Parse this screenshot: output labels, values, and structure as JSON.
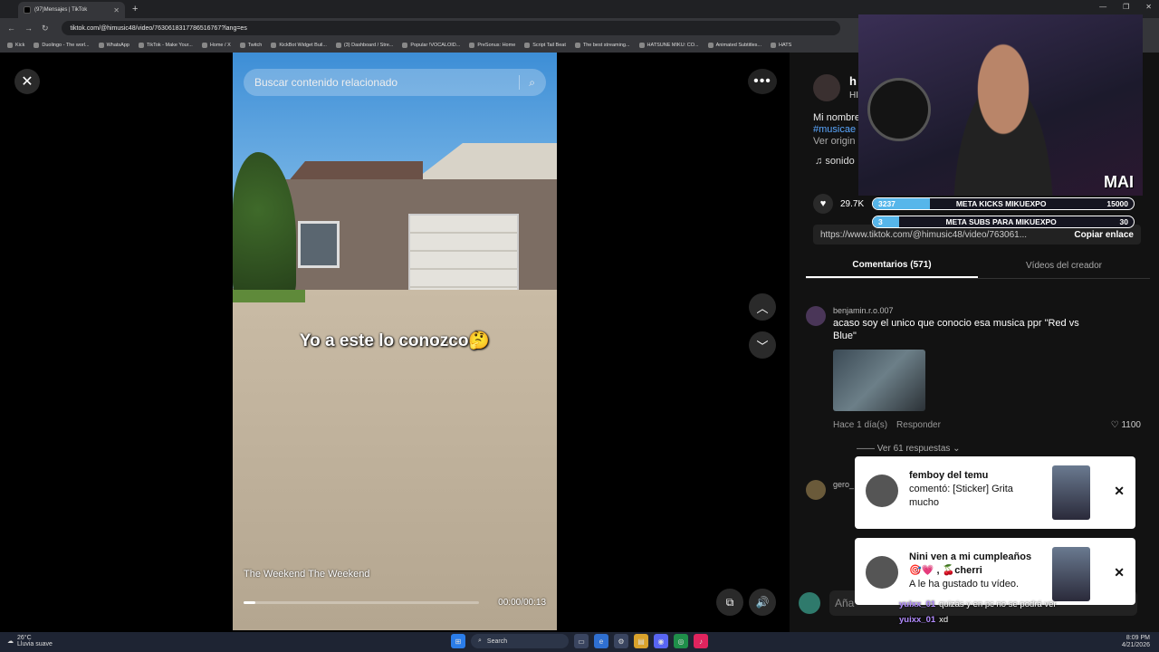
{
  "browser": {
    "tab_title": "(97)Mensajes | TikTok",
    "url": "tiktok.com/@himusic48/video/7630618317786516767?lang=es",
    "bookmarks": [
      "Kick",
      "Duolingo - The worl...",
      "WhatsApp",
      "TikTok - Make Your...",
      "Home / X",
      "Twitch",
      "KickBot Widget Buil...",
      "(3) Dashboard / Stre...",
      "Popular !VOCALOID...",
      "PreSonus: Home",
      "Script Tail Beat",
      "The best streaming...",
      "HATSUNE MIKU: CO...",
      "Animated Subtitles...",
      "HATS"
    ]
  },
  "video": {
    "search_placeholder": "Buscar contenido relacionado",
    "caption": "Yo a este lo conozco🤔",
    "music": "The Weekend The Weekend",
    "time": "00:00/00:13",
    "progress": 0.05
  },
  "author": {
    "name": "h",
    "sub": "HI",
    "desc_line1": "Mi nombre",
    "desc_tag": "#musicae",
    "desc_more": "Ver origin",
    "sound": "sonido"
  },
  "stats": {
    "likes": "29.7K"
  },
  "link": {
    "url": "https://www.tiktok.com/@himusic48/video/763061...",
    "copy_label": "Copiar enlace"
  },
  "tabs": {
    "comments": "Comentarios (571)",
    "creator": "Vídeos del creador"
  },
  "comments": [
    {
      "user": "benjamin.r.o.007",
      "text": "acaso soy el unico que conocio esa musica ppr \"Red vs Blue\"",
      "time": "Hace 1 día(s)",
      "reply": "Responder",
      "likes": "1100",
      "replies": "Ver 61 respuestas"
    },
    {
      "user": "gero_"
    }
  ],
  "comment_bar": {
    "placeholder": "Aña"
  },
  "overlay": {
    "mai": "MAI",
    "goal1": {
      "left": "3237",
      "label": "META KICKS MIKUEXPO",
      "right": "15000",
      "progress": 0.22
    },
    "goal2": {
      "left": "3",
      "label": "META SUBS PARA MIKUEXPO",
      "right": "30",
      "progress": 0.1
    },
    "notifications": [
      {
        "title": "femboy del temu",
        "body": "comentó: [Sticker] Grita mucho"
      },
      {
        "title": "Nini ven a mi cumpleaños 🎯💗 , 🍒cherri",
        "body": "A le ha gustado tu vídeo."
      }
    ],
    "chat": [
      {
        "user": "yuixx_01",
        "msg": "quizás y en pc no se podrá ver"
      },
      {
        "user": "yuixx_01",
        "msg": "xd"
      }
    ]
  },
  "taskbar": {
    "temp": "26°C",
    "weather": "Lluvia suave",
    "search": "Search",
    "time": "8:09 PM",
    "date": "4/21/2026"
  }
}
